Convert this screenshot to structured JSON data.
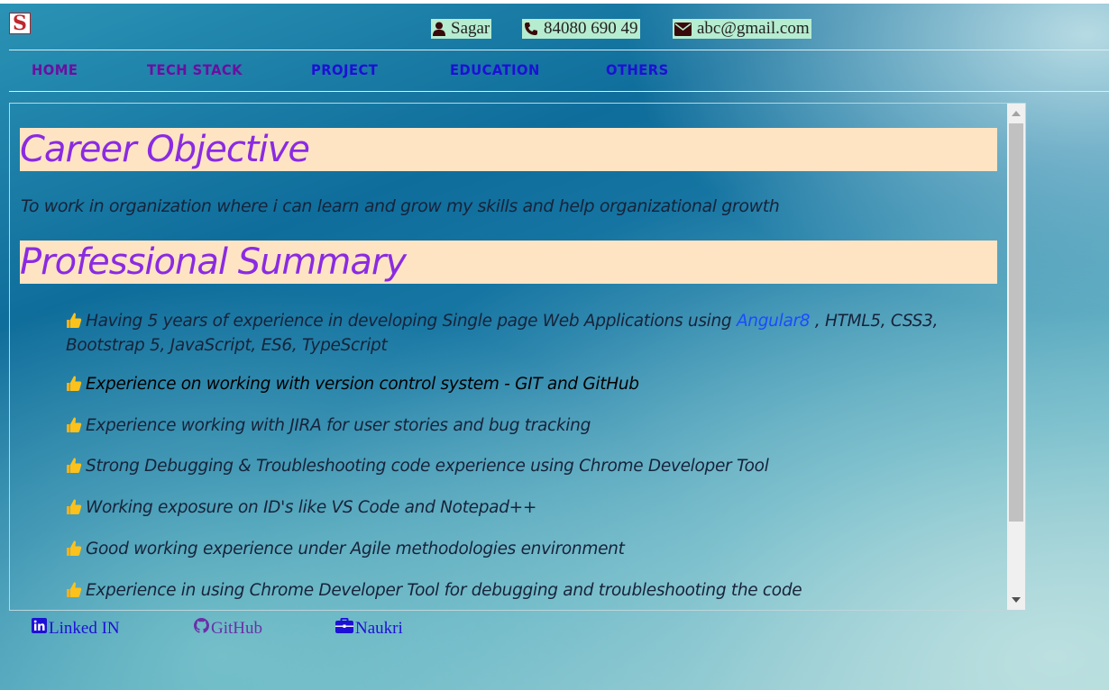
{
  "logo": {
    "letter": "S"
  },
  "contacts": {
    "name": "Sagar",
    "phone": "84080 690 49",
    "email": "abc@gmail.com"
  },
  "nav": [
    {
      "label": "HOME",
      "color": "#6b0fa0"
    },
    {
      "label": "TECH STACK",
      "color": "#6b0fa0"
    },
    {
      "label": "PROJECT",
      "color": "#1d10d6"
    },
    {
      "label": "EDUCATION",
      "color": "#1d10d6"
    },
    {
      "label": "OTHERS",
      "color": "#1d10d6"
    }
  ],
  "content": {
    "career_heading": "Career Objective",
    "career_text": "To work in organization where i can learn and grow my skills and help organizational growth",
    "summary_heading": "Professional Summary",
    "summary_items": [
      {
        "prefix": "Having 5 years of experience in developing Single page Web Applications using ",
        "link": "Angular8",
        "suffix": " , HTML5, CSS3, Bootstrap 5, JavaScript, ES6, TypeScript"
      },
      {
        "text": "Experience on working with version control system - GIT and GitHub"
      },
      {
        "text": "Experience working with JIRA for user stories and bug tracking"
      },
      {
        "text": "Strong Debugging & Troubleshooting code experience using Chrome Developer Tool"
      },
      {
        "text": "Working exposure on ID's like VS Code and Notepad++"
      },
      {
        "text": "Good working experience under Agile methodologies environment"
      },
      {
        "text": "Experience in using Chrome Developer Tool for debugging and troubleshooting the code"
      }
    ]
  },
  "footer": {
    "linkedin": "Linked IN",
    "github": "GitHub",
    "naukri": "Naukri"
  },
  "colors": {
    "heading_bg": "#ffe4c4",
    "heading_text": "#8a2be2",
    "contact_bg": "#b6ecd0",
    "footer_link": "#1d10d6",
    "footer_link_visited": "#6b2fa8"
  }
}
